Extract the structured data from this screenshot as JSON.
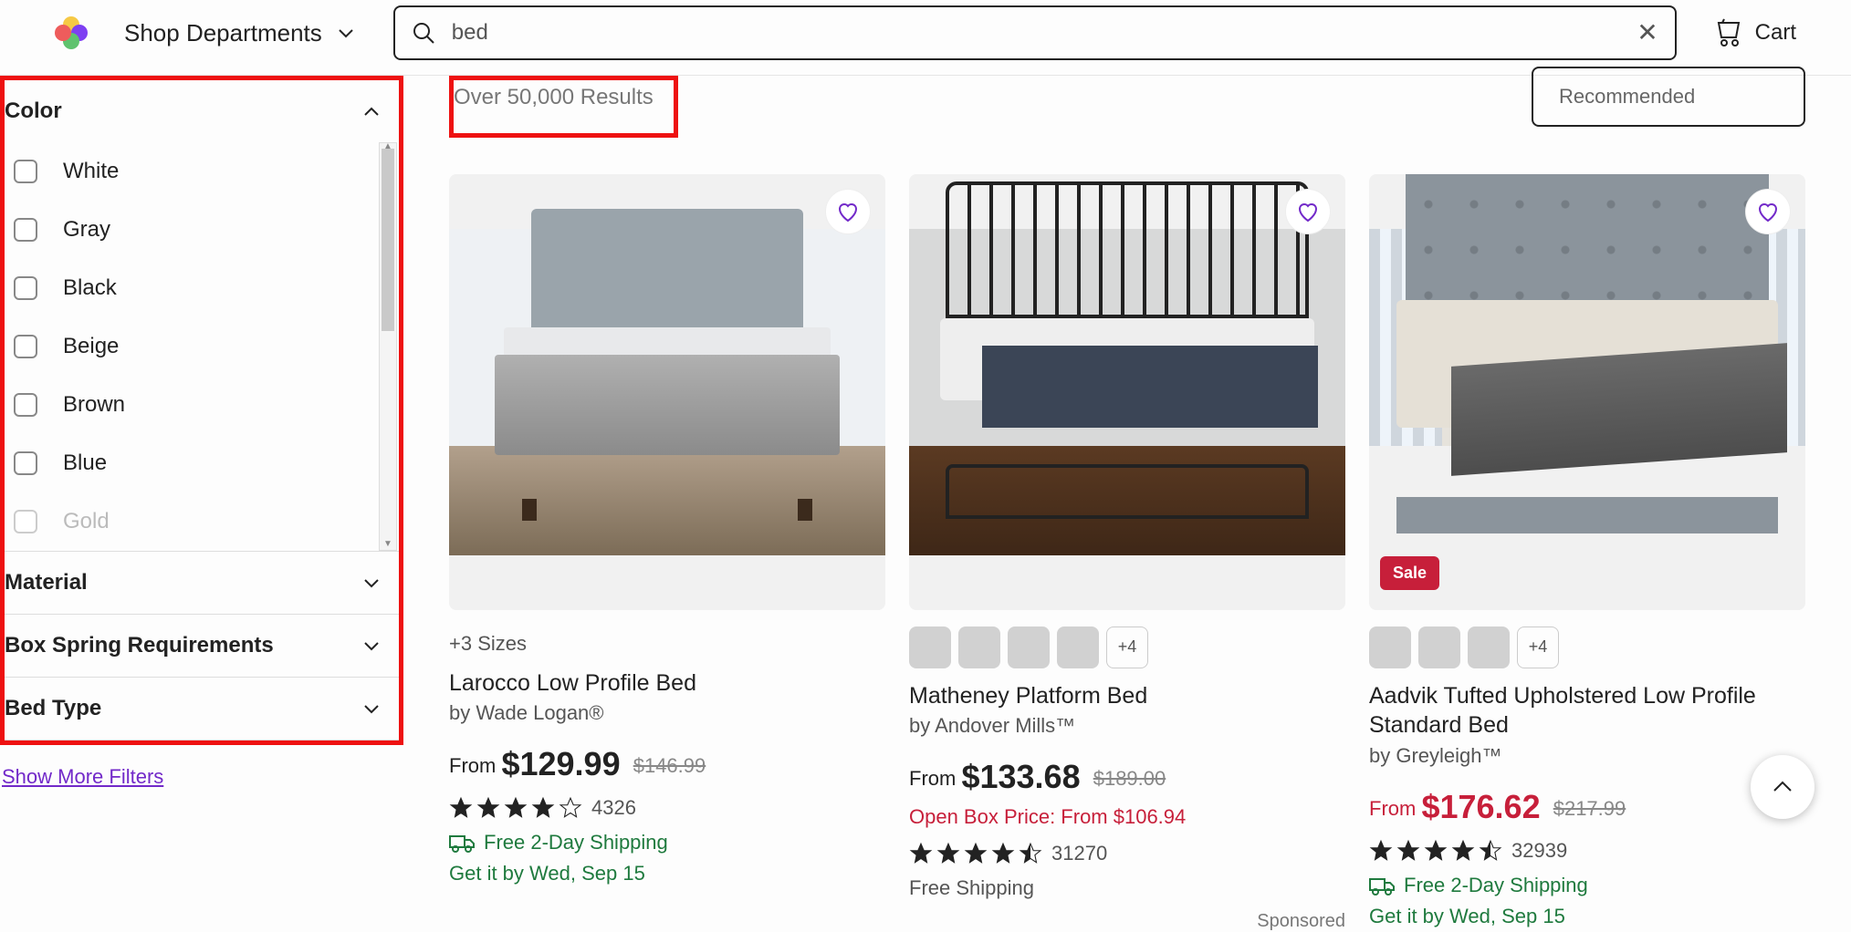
{
  "header": {
    "departments_label": "Shop Departments",
    "search_value": "bed",
    "cart_label": "Cart"
  },
  "sort": {
    "label": "Recommended"
  },
  "results_count": "Over 50,000 Results",
  "filters": {
    "color_header": "Color",
    "colors": [
      "White",
      "Gray",
      "Black",
      "Beige",
      "Brown",
      "Blue",
      "Gold"
    ],
    "material_header": "Material",
    "boxspring_header": "Box Spring Requirements",
    "bedtype_header": "Bed Type",
    "show_more": "Show More Filters"
  },
  "products": [
    {
      "sizes": "+3 Sizes",
      "title": "Larocco Low Profile Bed",
      "byline": "by Wade Logan®",
      "from": "From",
      "price": "$129.99",
      "old_price": "$146.99",
      "sale": false,
      "rating": 4.0,
      "reviews": "4326",
      "ship_text": "Free 2-Day Shipping",
      "ship_icon": true,
      "getby": "Get it by Wed, Sep 15",
      "openbox": "",
      "swatches": 0,
      "swatch_more": "",
      "sponsored": ""
    },
    {
      "sizes": "",
      "title": "Matheney Platform Bed",
      "byline": "by Andover Mills™",
      "from": "From",
      "price": "$133.68",
      "old_price": "$189.00",
      "sale": false,
      "rating": 4.5,
      "reviews": "31270",
      "ship_text": "Free Shipping",
      "ship_icon": false,
      "getby": "",
      "openbox": "Open Box Price: From $106.94",
      "swatches": 4,
      "swatch_more": "+4",
      "sponsored": "Sponsored"
    },
    {
      "sizes": "",
      "title": "Aadvik Tufted Upholstered Low Profile Standard Bed",
      "byline": "by Greyleigh™",
      "from": "From",
      "price": "$176.62",
      "old_price": "$217.99",
      "sale": true,
      "rating": 4.5,
      "reviews": "32939",
      "ship_text": "Free 2-Day Shipping",
      "ship_icon": true,
      "getby": "Get it by Wed, Sep 15",
      "openbox": "",
      "swatches": 3,
      "swatch_more": "+4",
      "sponsored": "",
      "saletag": "Sale"
    }
  ]
}
